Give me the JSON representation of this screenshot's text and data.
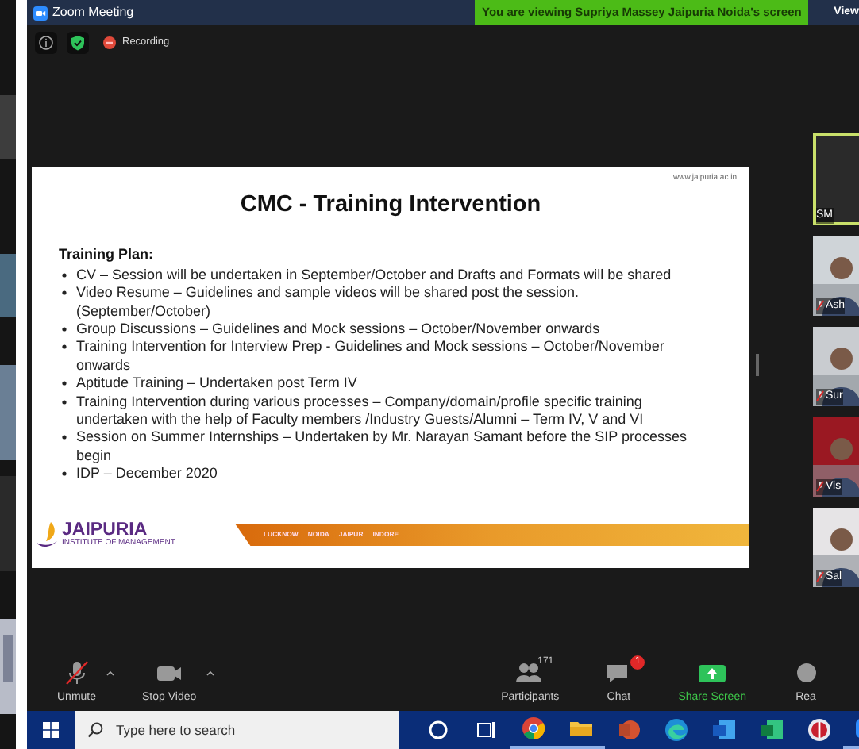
{
  "window": {
    "title": "Zoom Meeting"
  },
  "banner": "You are viewing Supriya Massey Jaipuria Noida's screen",
  "view_button": "View",
  "status": {
    "recording": "Recording"
  },
  "slide": {
    "url": "www.jaipuria.ac.in",
    "title": "CMC - Training Intervention",
    "heading": "Training Plan:",
    "bullets": [
      "CV – Session will be undertaken in September/October and Drafts and Formats will be shared",
      "Video Resume – Guidelines and sample videos will be shared post the session. (September/October)",
      "Group Discussions – Guidelines and Mock sessions – October/November onwards",
      "Training Intervention for Interview Prep - Guidelines and Mock sessions – October/November onwards",
      "Aptitude Training – Undertaken post Term IV",
      "Training Intervention during various processes – Company/domain/profile specific training undertaken with the help of Faculty members /Industry Guests/Alumni – Term IV, V and VI",
      "Session on Summer Internships – Undertaken by Mr. Narayan Samant before the SIP processes begin",
      "IDP – December 2020"
    ],
    "logo": {
      "name": "JAIPURIA",
      "tagline": "INSTITUTE OF MANAGEMENT"
    },
    "cities": [
      "LUCKNOW",
      "NOIDA",
      "JAIPUR",
      "INDORE"
    ]
  },
  "videos": [
    {
      "label": "SM",
      "kind": "initials",
      "speaking": true,
      "muted": false
    },
    {
      "label": "Ash",
      "kind": "video",
      "speaking": false,
      "muted": true
    },
    {
      "label": "Sur",
      "kind": "video",
      "speaking": false,
      "muted": true
    },
    {
      "label": "Vis",
      "kind": "video",
      "speaking": false,
      "muted": true
    },
    {
      "label": "Sal",
      "kind": "video",
      "speaking": false,
      "muted": true
    }
  ],
  "toolbar": {
    "left": [
      {
        "label": "Unmute",
        "kind": "mic"
      },
      {
        "label": "Stop Video",
        "kind": "camera"
      }
    ],
    "right": [
      {
        "label": "Participants",
        "kind": "participants",
        "count": "171"
      },
      {
        "label": "Chat",
        "kind": "chat",
        "badge": "1"
      },
      {
        "label": "Share Screen",
        "kind": "share"
      },
      {
        "label": "Rea",
        "kind": "reactions"
      }
    ]
  },
  "taskbar": {
    "search_placeholder": "Type here to search",
    "apps": [
      {
        "kind": "cortana",
        "running": false
      },
      {
        "kind": "taskview",
        "running": false
      },
      {
        "kind": "chrome",
        "running": true
      },
      {
        "kind": "folder",
        "running": true
      },
      {
        "kind": "slides",
        "running": false
      },
      {
        "kind": "edge",
        "running": false
      },
      {
        "kind": "doc",
        "running": false
      },
      {
        "kind": "sheet",
        "running": false
      },
      {
        "kind": "red",
        "running": false
      },
      {
        "kind": "zoom",
        "running": true
      }
    ]
  }
}
